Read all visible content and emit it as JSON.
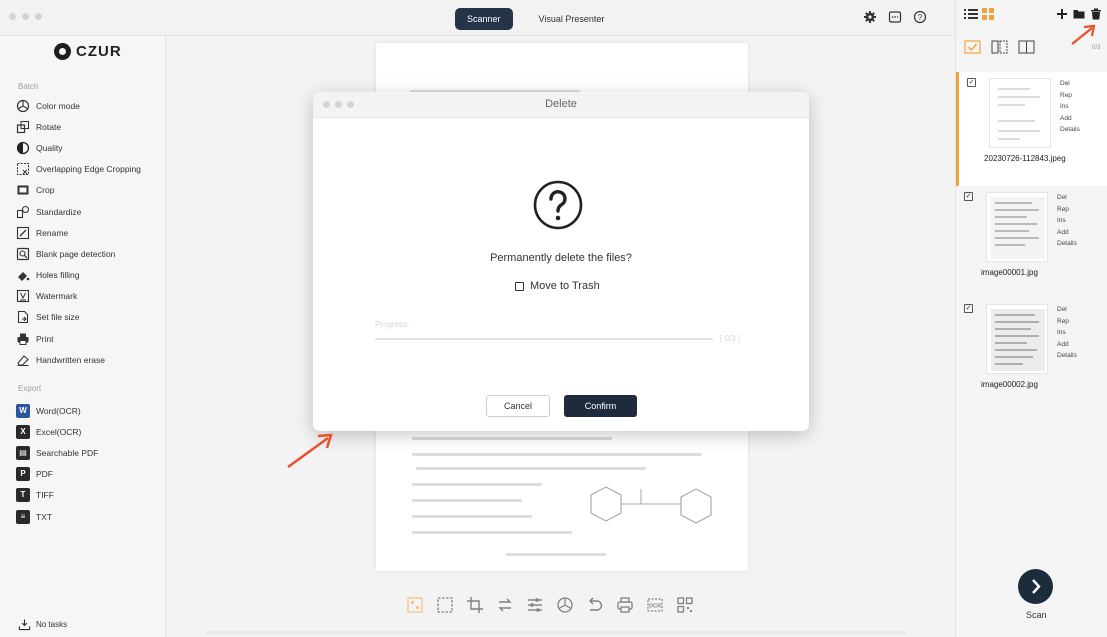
{
  "app": {
    "logo_text": "CZUR"
  },
  "topbar": {
    "modes": [
      {
        "label": "Scanner",
        "active": true
      },
      {
        "label": "Visual Presenter",
        "active": false
      }
    ],
    "icons": [
      "settings-gear-icon",
      "preview-window-icon",
      "help-icon"
    ]
  },
  "sidebar": {
    "batch_title": "Batch",
    "batch_items": [
      {
        "label": "Color mode",
        "icon": "color-mode-icon"
      },
      {
        "label": "Rotate",
        "icon": "rotate-icon"
      },
      {
        "label": "Quality",
        "icon": "quality-icon"
      },
      {
        "label": "Overlapping Edge Cropping",
        "icon": "edge-crop-icon"
      },
      {
        "label": "Crop",
        "icon": "crop-icon"
      },
      {
        "label": "Standardize",
        "icon": "standardize-icon"
      },
      {
        "label": "Rename",
        "icon": "rename-icon"
      },
      {
        "label": "Blank page detection",
        "icon": "blank-page-icon"
      },
      {
        "label": "Holes filling",
        "icon": "holes-filling-icon"
      },
      {
        "label": "Watermark",
        "icon": "watermark-icon"
      },
      {
        "label": "Set file size",
        "icon": "file-size-icon"
      },
      {
        "label": "Print",
        "icon": "print-icon"
      },
      {
        "label": "Handwritten erase",
        "icon": "eraser-icon"
      }
    ],
    "export_title": "Export",
    "export_items": [
      {
        "label": "Word(OCR)",
        "glyph": "W",
        "color": "#2b579a"
      },
      {
        "label": "Excel(OCR)",
        "glyph": "X",
        "color": "#2a2a2a"
      },
      {
        "label": "Searchable PDF",
        "glyph": "▤",
        "color": "#2a2a2a"
      },
      {
        "label": "PDF",
        "glyph": "P",
        "color": "#2a2a2a"
      },
      {
        "label": "TIFF",
        "glyph": "T",
        "color": "#2a2a2a"
      },
      {
        "label": "TXT",
        "glyph": "≡",
        "color": "#2a2a2a"
      }
    ],
    "tasks_label": "No tasks"
  },
  "right_panel": {
    "count": "0/3",
    "thumbnails": [
      {
        "name": "20230726-112843.jpeg",
        "active": true
      },
      {
        "name": "image00001.jpg",
        "active": false
      },
      {
        "name": "image00002.jpg",
        "active": false
      }
    ],
    "actions": [
      "Del",
      "Rep",
      "Ins",
      "Add",
      "Details"
    ],
    "scan_label": "Scan"
  },
  "dialog": {
    "title": "Delete",
    "message": "Permanently delete the files?",
    "checkbox_label": "Move to Trash",
    "progress_label": "Progress:",
    "progress_text": "[ 0/3 ]",
    "cancel_label": "Cancel",
    "confirm_label": "Confirm"
  },
  "colors": {
    "accent": "#f2a33c",
    "primary_dark": "#1e2b3c",
    "annotation_arrow": "#e8502a"
  }
}
